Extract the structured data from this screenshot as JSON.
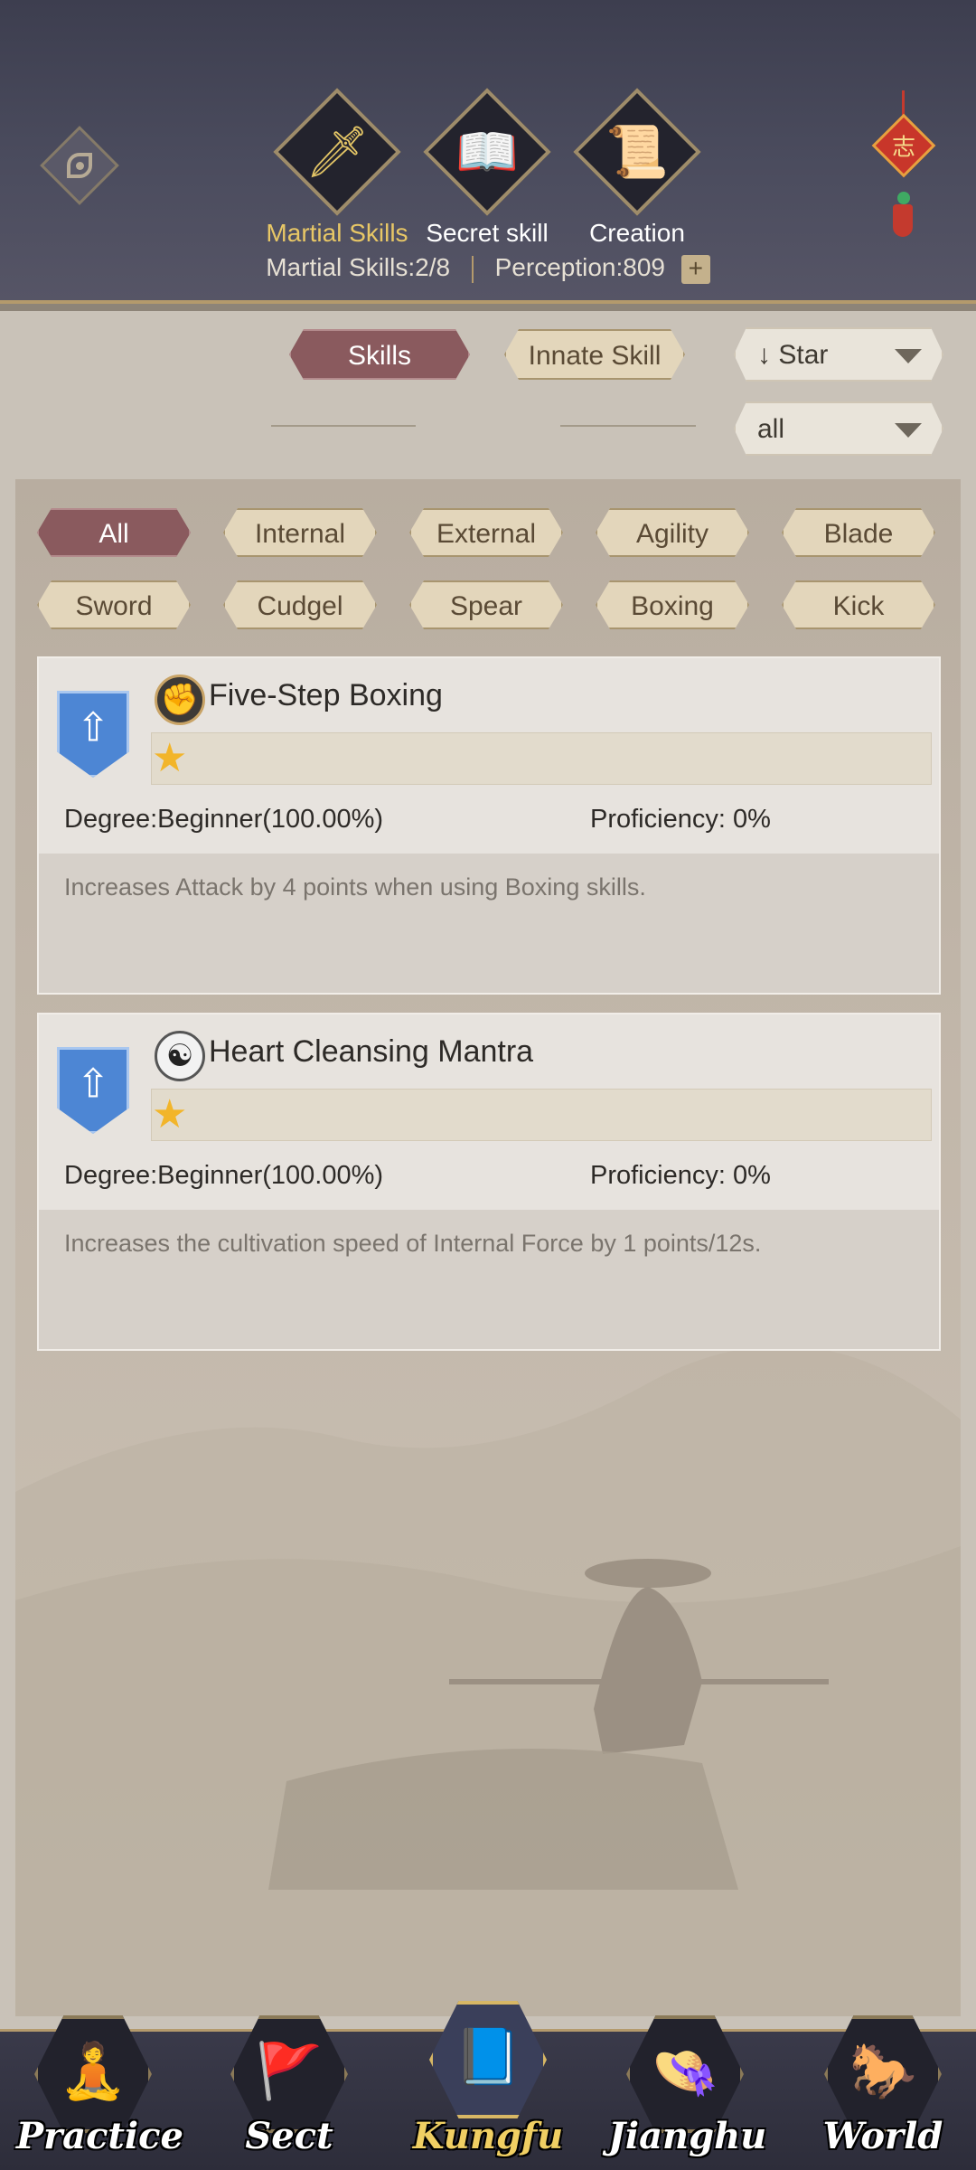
{
  "header": {
    "tabs": [
      {
        "label": "Martial Skills",
        "icon": "sword-icon",
        "active": true
      },
      {
        "label": "Secret skill",
        "icon": "book-icon",
        "active": false
      },
      {
        "label": "Creation",
        "icon": "scroll-icon",
        "active": false
      }
    ],
    "stats": {
      "martial_skills": "Martial Skills:2/8",
      "perception": "Perception:809",
      "plus": "+"
    },
    "charm_glyph": "志"
  },
  "filters": {
    "type_tabs": [
      {
        "label": "Skills",
        "active": true
      },
      {
        "label": "Innate Skill",
        "active": false
      }
    ],
    "sort": {
      "label": "Star",
      "arrow": "↓"
    },
    "scope": {
      "label": "all"
    },
    "categories": [
      "All",
      "Internal",
      "External",
      "Agility",
      "Blade",
      "Sword",
      "Cudgel",
      "Spear",
      "Boxing",
      "Kick"
    ],
    "active_category": "All"
  },
  "skills": [
    {
      "name": "Five-Step Boxing",
      "icon": "fist-icon",
      "stars": 1,
      "degree": "Degree:Beginner(100.00%)",
      "proficiency": "Proficiency: 0%",
      "description": "Increases Attack by 4 points when using Boxing skills."
    },
    {
      "name": "Heart Cleansing Mantra",
      "icon": "yin-yang-icon",
      "stars": 1,
      "degree": "Degree:Beginner(100.00%)",
      "proficiency": "Proficiency: 0%",
      "description": "Increases the cultivation speed of Internal Force by 1 points/12s."
    }
  ],
  "bottom_nav": [
    {
      "label": "Practice",
      "icon": "monk-icon",
      "active": false
    },
    {
      "label": "Sect",
      "icon": "banner-icon",
      "active": false
    },
    {
      "label": "Kungfu",
      "icon": "manual-icon",
      "active": true
    },
    {
      "label": "Jianghu",
      "icon": "bamboo-hat-icon",
      "active": false
    },
    {
      "label": "World",
      "icon": "horse-icon",
      "active": false
    }
  ],
  "colors": {
    "accent_gold": "#e8c766",
    "active_tag": "#8a5a5e",
    "tag_bg": "#e3d6bb",
    "header_bg": "#4b4c5e"
  }
}
